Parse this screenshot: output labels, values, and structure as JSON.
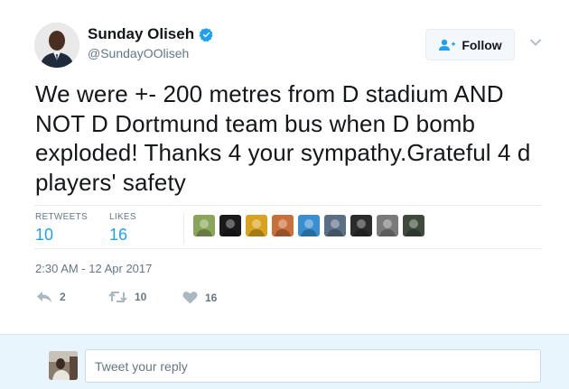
{
  "author": {
    "display_name": "Sunday Oliseh",
    "handle": "@SundayOOliseh",
    "verified": true
  },
  "follow_button": {
    "label": "Follow"
  },
  "tweet": {
    "text": "We were +- 200 metres from D stadium AND NOT D Dortmund team bus when D bomb exploded! Thanks 4 your sympathy.Grateful 4 d players' safety",
    "timestamp": "2:30 AM - 12 Apr 2017"
  },
  "stats": {
    "retweets_label": "RETWEETS",
    "retweets_count": "10",
    "likes_label": "LIKES",
    "likes_count": "16"
  },
  "likers": [
    {
      "icon": "liker-avatar-1",
      "color": "#8aa65a"
    },
    {
      "icon": "liker-avatar-2",
      "color": "#1a1a1a"
    },
    {
      "icon": "liker-avatar-3",
      "color": "#d9a321"
    },
    {
      "icon": "liker-avatar-4",
      "color": "#c96f3a"
    },
    {
      "icon": "liker-avatar-5",
      "color": "#3a8fd1"
    },
    {
      "icon": "liker-avatar-6",
      "color": "#5a6e86"
    },
    {
      "icon": "liker-avatar-7",
      "color": "#2b2b2b"
    },
    {
      "icon": "liker-avatar-8",
      "color": "#7a7a7a"
    },
    {
      "icon": "liker-avatar-9",
      "color": "#3f4a3c"
    }
  ],
  "actions": {
    "reply_count": "2",
    "retweet_count": "10",
    "like_count": "16"
  },
  "reply": {
    "placeholder": "Tweet your reply"
  },
  "colors": {
    "accent": "#1da1f2",
    "muted": "#657786",
    "reply_bg": "#e8f5fd"
  }
}
